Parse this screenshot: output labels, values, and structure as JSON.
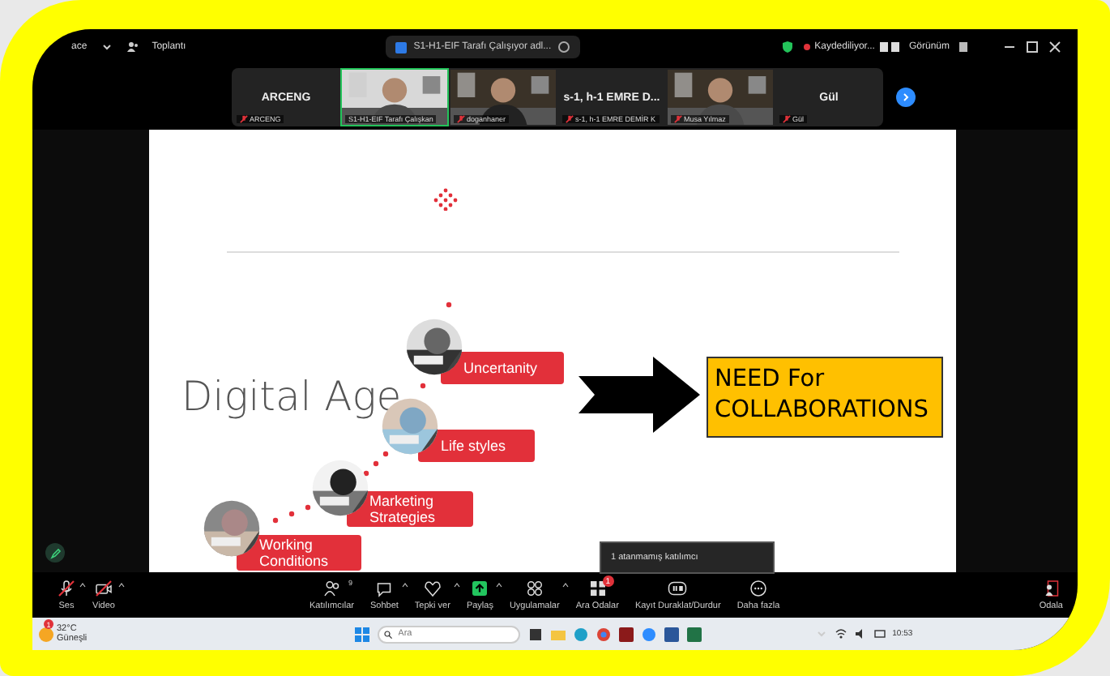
{
  "top_bar": {
    "app_name": "ace",
    "menu": "Toplantı",
    "meeting_title": "S1-H1-EIF Tarafı Çalışıyor adl...",
    "recording": "Kaydediliyor...",
    "view": "Görünüm"
  },
  "participants": [
    {
      "kind": "name",
      "display": "ARCENG",
      "label": "ARCENG",
      "muted": true,
      "active": false
    },
    {
      "kind": "video",
      "label": "S1-H1-EIF Tarafı Çalışkan",
      "muted": false,
      "active": true
    },
    {
      "kind": "video",
      "label": "doganhaner",
      "muted": true,
      "active": false
    },
    {
      "kind": "name",
      "display": "s-1, h-1 EMRE D...",
      "label": "s-1, h-1 EMRE DEMİR K",
      "muted": true,
      "active": false
    },
    {
      "kind": "video",
      "label": "Musa Yılmaz",
      "muted": true,
      "active": false
    },
    {
      "kind": "name",
      "display": "Gül",
      "label": "Gül",
      "muted": true,
      "active": false
    }
  ],
  "slide": {
    "title": "Digital Age",
    "steps": [
      {
        "label": "Uncertanity"
      },
      {
        "label": "Life styles"
      },
      {
        "label": "Marketing Strategies"
      },
      {
        "label": "Working Conditions"
      }
    ],
    "result_lines": [
      "NEED For",
      "COLLABORATIONS"
    ]
  },
  "tooltip": "1 atanmamış katılımcı",
  "toolbar": [
    {
      "kind": "mic",
      "label": "Ses",
      "off": true,
      "caret": true
    },
    {
      "kind": "camera",
      "label": "Video",
      "off": true,
      "caret": true
    },
    {
      "kind": "participants",
      "label": "Katılımcılar",
      "count": "9",
      "off": false,
      "caret": false
    },
    {
      "kind": "chat",
      "label": "Sohbet",
      "off": false,
      "caret": true
    },
    {
      "kind": "reaction",
      "label": "Tepki ver",
      "off": false,
      "caret": true
    },
    {
      "kind": "share",
      "label": "Paylaş",
      "off": false,
      "caret": true
    },
    {
      "kind": "apps",
      "label": "Uygulamalar",
      "off": false,
      "caret": true
    },
    {
      "kind": "rooms",
      "label": "Ara Odalar",
      "badge": "1",
      "off": false,
      "caret": false
    },
    {
      "kind": "record",
      "label": "Kayıt Duraklat/Durdur",
      "off": false,
      "caret": false
    },
    {
      "kind": "more",
      "label": "Daha fazla",
      "off": false,
      "caret": false
    },
    {
      "kind": "leave_rooms",
      "label": "Odala",
      "off": false,
      "caret": false
    }
  ],
  "taskbar": {
    "weather": "32°C",
    "weather_note": "Güneşli",
    "weather_badge": "1",
    "search_placeholder": "Ara",
    "time": "10:53"
  }
}
